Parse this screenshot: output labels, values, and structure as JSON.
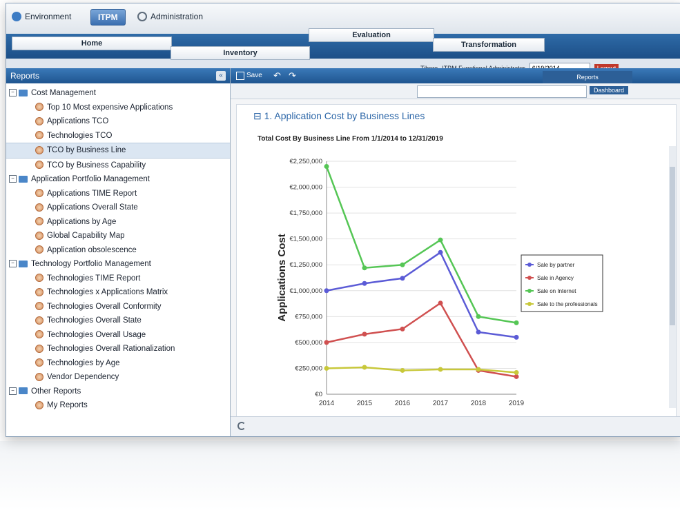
{
  "topbar": {
    "environment_label": "Environment",
    "itpm_label": "ITPM",
    "administration_label": "Administration"
  },
  "tabs": {
    "home": "Home",
    "inventory": "Inventory",
    "evaluation": "Evaluation",
    "transformation": "Transformation"
  },
  "userbar": {
    "user": "Tibere",
    "role": "ITPM Functional Administrator",
    "date": "6/19/2014",
    "logout": "Logout"
  },
  "sidebar": {
    "header": "Reports",
    "collapse_label": "«",
    "tree": [
      {
        "type": "group",
        "label": "Cost Management"
      },
      {
        "type": "leaf",
        "label": "Top 10 Most expensive Applications"
      },
      {
        "type": "leaf",
        "label": "Applications TCO"
      },
      {
        "type": "leaf",
        "label": "Technologies TCO"
      },
      {
        "type": "leaf",
        "label": "TCO by Business Line",
        "selected": true
      },
      {
        "type": "leaf",
        "label": "TCO by Business Capability"
      },
      {
        "type": "group",
        "label": "Application Portfolio Management"
      },
      {
        "type": "leaf",
        "label": "Applications TIME Report"
      },
      {
        "type": "leaf",
        "label": "Applications Overall State"
      },
      {
        "type": "leaf",
        "label": "Applications by Age"
      },
      {
        "type": "leaf",
        "label": "Global Capability Map"
      },
      {
        "type": "leaf",
        "label": "Application obsolescence"
      },
      {
        "type": "group",
        "label": "Technology Portfolio Management"
      },
      {
        "type": "leaf",
        "label": "Technologies TIME Report"
      },
      {
        "type": "leaf",
        "label": "Technologies x Applications Matrix"
      },
      {
        "type": "leaf",
        "label": "Technologies Overall Conformity"
      },
      {
        "type": "leaf",
        "label": "Technologies Overall State"
      },
      {
        "type": "leaf",
        "label": "Technologies Overall Usage"
      },
      {
        "type": "leaf",
        "label": "Technologies Overall Rationalization"
      },
      {
        "type": "leaf",
        "label": "Technologies by Age"
      },
      {
        "type": "leaf",
        "label": "Vendor Dependency"
      },
      {
        "type": "group",
        "label": "Other Reports"
      },
      {
        "type": "leaf",
        "label": "My Reports"
      }
    ]
  },
  "toolbar": {
    "save_label": "Save",
    "reports_tab": "Reports",
    "dashboard_label": "Dashboard"
  },
  "main": {
    "section_title": "1. Application Cost by Business Lines"
  },
  "chart_data": {
    "type": "line",
    "title": "Total Cost By Business Line From 1/1/2014 to 12/31/2019",
    "xlabel": "",
    "ylabel": "Applications Cost",
    "x": [
      "2014",
      "2015",
      "2016",
      "2017",
      "2018",
      "2019"
    ],
    "ylim": [
      0,
      2250000
    ],
    "yticks": [
      "€0",
      "€250,000",
      "€500,000",
      "€750,000",
      "€1,000,000",
      "€1,250,000",
      "€1,500,000",
      "€1,750,000",
      "€2,000,000",
      "€2,250,000"
    ],
    "grid": true,
    "legend_position": "right",
    "series": [
      {
        "name": "Sale by partner",
        "color": "#5b5bd6",
        "values": [
          1000000,
          1070000,
          1120000,
          1370000,
          600000,
          550000
        ]
      },
      {
        "name": "Sale in Agency",
        "color": "#d05050",
        "values": [
          500000,
          580000,
          630000,
          880000,
          230000,
          170000
        ]
      },
      {
        "name": "Sale on Internet",
        "color": "#55c655",
        "values": [
          2200000,
          1220000,
          1250000,
          1490000,
          750000,
          690000
        ]
      },
      {
        "name": "Sale to the professionals",
        "color": "#c8c83a",
        "values": [
          250000,
          260000,
          230000,
          240000,
          240000,
          210000
        ]
      }
    ]
  }
}
